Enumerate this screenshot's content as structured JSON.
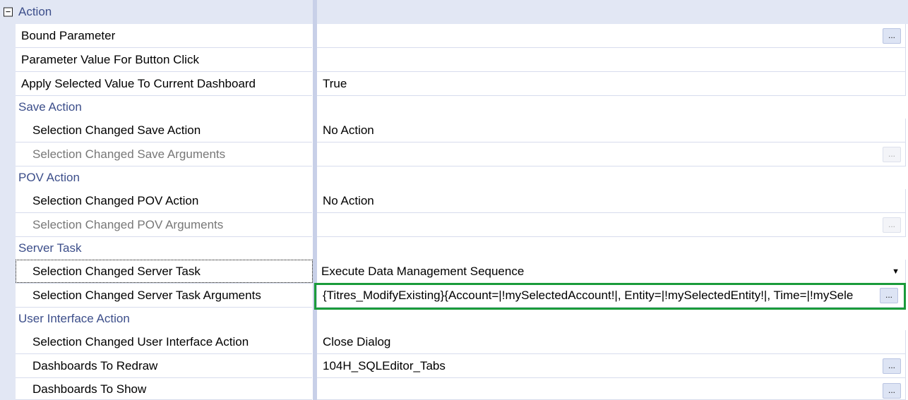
{
  "header": {
    "title": "Action",
    "collapse_glyph": "−"
  },
  "rows": {
    "bound_parameter": {
      "name": "Bound Parameter",
      "value": "",
      "button": "..."
    },
    "param_value_button_click": {
      "name": "Parameter Value For Button Click",
      "value": ""
    },
    "apply_selected_value": {
      "name": "Apply Selected Value To Current Dashboard",
      "value": "True"
    },
    "save_action_cat": {
      "name": "Save Action"
    },
    "sel_changed_save_action": {
      "name": "Selection Changed Save Action",
      "value": "No Action"
    },
    "sel_changed_save_args": {
      "name": "Selection Changed Save Arguments",
      "value": "",
      "button": "..."
    },
    "pov_action_cat": {
      "name": "POV Action"
    },
    "sel_changed_pov_action": {
      "name": "Selection Changed POV Action",
      "value": "No Action"
    },
    "sel_changed_pov_args": {
      "name": "Selection Changed POV Arguments",
      "value": "",
      "button": "..."
    },
    "server_task_cat": {
      "name": "Server Task"
    },
    "sel_changed_server_task": {
      "name": "Selection Changed Server Task",
      "value": "Execute Data Management Sequence",
      "arrow": "▼"
    },
    "sel_changed_server_task_args": {
      "name": "Selection Changed Server Task Arguments",
      "value": "{Titres_ModifyExisting}{Account=|!mySelectedAccount!|, Entity=|!mySelectedEntity!|, Time=|!mySele",
      "button": "..."
    },
    "ui_action_cat": {
      "name": "User Interface Action"
    },
    "sel_changed_ui_action": {
      "name": "Selection Changed User Interface Action",
      "value": "Close Dialog"
    },
    "dashboards_to_redraw": {
      "name": "Dashboards To Redraw",
      "value": "104H_SQLEditor_Tabs",
      "button": "..."
    },
    "dashboards_to_show": {
      "name": "Dashboards To Show",
      "value": "",
      "button": "..."
    }
  },
  "colors": {
    "category_bg": "#e2e7f4",
    "category_text": "#3c4e8a",
    "highlight": "#1a9b3a",
    "grid_line": "#d7dced"
  }
}
